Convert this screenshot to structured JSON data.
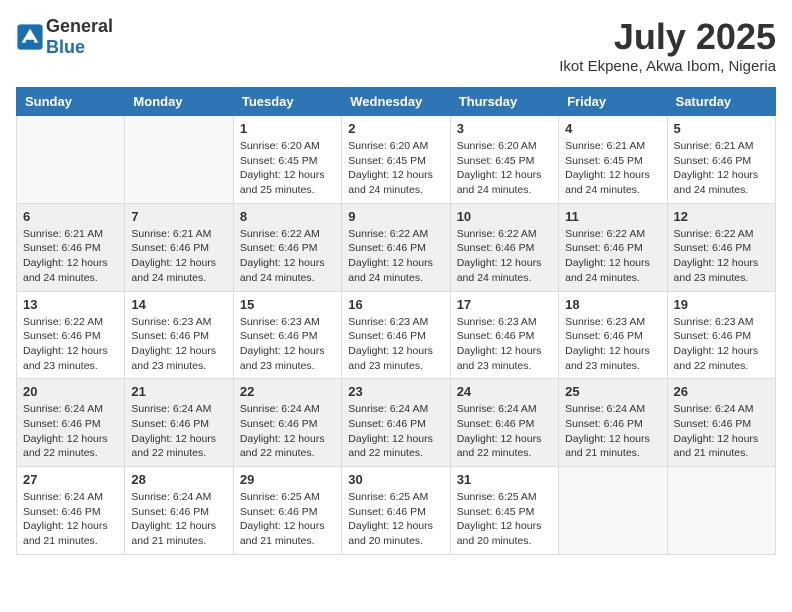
{
  "logo": {
    "general": "General",
    "blue": "Blue"
  },
  "header": {
    "month": "July 2025",
    "location": "Ikot Ekpene, Akwa Ibom, Nigeria"
  },
  "weekdays": [
    "Sunday",
    "Monday",
    "Tuesday",
    "Wednesday",
    "Thursday",
    "Friday",
    "Saturday"
  ],
  "weeks": [
    [
      {
        "day": "",
        "sunrise": "",
        "sunset": "",
        "daylight": "",
        "empty": true
      },
      {
        "day": "",
        "sunrise": "",
        "sunset": "",
        "daylight": "",
        "empty": true
      },
      {
        "day": "1",
        "sunrise": "Sunrise: 6:20 AM",
        "sunset": "Sunset: 6:45 PM",
        "daylight": "Daylight: 12 hours and 25 minutes."
      },
      {
        "day": "2",
        "sunrise": "Sunrise: 6:20 AM",
        "sunset": "Sunset: 6:45 PM",
        "daylight": "Daylight: 12 hours and 24 minutes."
      },
      {
        "day": "3",
        "sunrise": "Sunrise: 6:20 AM",
        "sunset": "Sunset: 6:45 PM",
        "daylight": "Daylight: 12 hours and 24 minutes."
      },
      {
        "day": "4",
        "sunrise": "Sunrise: 6:21 AM",
        "sunset": "Sunset: 6:45 PM",
        "daylight": "Daylight: 12 hours and 24 minutes."
      },
      {
        "day": "5",
        "sunrise": "Sunrise: 6:21 AM",
        "sunset": "Sunset: 6:46 PM",
        "daylight": "Daylight: 12 hours and 24 minutes."
      }
    ],
    [
      {
        "day": "6",
        "sunrise": "Sunrise: 6:21 AM",
        "sunset": "Sunset: 6:46 PM",
        "daylight": "Daylight: 12 hours and 24 minutes."
      },
      {
        "day": "7",
        "sunrise": "Sunrise: 6:21 AM",
        "sunset": "Sunset: 6:46 PM",
        "daylight": "Daylight: 12 hours and 24 minutes."
      },
      {
        "day": "8",
        "sunrise": "Sunrise: 6:22 AM",
        "sunset": "Sunset: 6:46 PM",
        "daylight": "Daylight: 12 hours and 24 minutes."
      },
      {
        "day": "9",
        "sunrise": "Sunrise: 6:22 AM",
        "sunset": "Sunset: 6:46 PM",
        "daylight": "Daylight: 12 hours and 24 minutes."
      },
      {
        "day": "10",
        "sunrise": "Sunrise: 6:22 AM",
        "sunset": "Sunset: 6:46 PM",
        "daylight": "Daylight: 12 hours and 24 minutes."
      },
      {
        "day": "11",
        "sunrise": "Sunrise: 6:22 AM",
        "sunset": "Sunset: 6:46 PM",
        "daylight": "Daylight: 12 hours and 24 minutes."
      },
      {
        "day": "12",
        "sunrise": "Sunrise: 6:22 AM",
        "sunset": "Sunset: 6:46 PM",
        "daylight": "Daylight: 12 hours and 23 minutes."
      }
    ],
    [
      {
        "day": "13",
        "sunrise": "Sunrise: 6:22 AM",
        "sunset": "Sunset: 6:46 PM",
        "daylight": "Daylight: 12 hours and 23 minutes."
      },
      {
        "day": "14",
        "sunrise": "Sunrise: 6:23 AM",
        "sunset": "Sunset: 6:46 PM",
        "daylight": "Daylight: 12 hours and 23 minutes."
      },
      {
        "day": "15",
        "sunrise": "Sunrise: 6:23 AM",
        "sunset": "Sunset: 6:46 PM",
        "daylight": "Daylight: 12 hours and 23 minutes."
      },
      {
        "day": "16",
        "sunrise": "Sunrise: 6:23 AM",
        "sunset": "Sunset: 6:46 PM",
        "daylight": "Daylight: 12 hours and 23 minutes."
      },
      {
        "day": "17",
        "sunrise": "Sunrise: 6:23 AM",
        "sunset": "Sunset: 6:46 PM",
        "daylight": "Daylight: 12 hours and 23 minutes."
      },
      {
        "day": "18",
        "sunrise": "Sunrise: 6:23 AM",
        "sunset": "Sunset: 6:46 PM",
        "daylight": "Daylight: 12 hours and 23 minutes."
      },
      {
        "day": "19",
        "sunrise": "Sunrise: 6:23 AM",
        "sunset": "Sunset: 6:46 PM",
        "daylight": "Daylight: 12 hours and 22 minutes."
      }
    ],
    [
      {
        "day": "20",
        "sunrise": "Sunrise: 6:24 AM",
        "sunset": "Sunset: 6:46 PM",
        "daylight": "Daylight: 12 hours and 22 minutes."
      },
      {
        "day": "21",
        "sunrise": "Sunrise: 6:24 AM",
        "sunset": "Sunset: 6:46 PM",
        "daylight": "Daylight: 12 hours and 22 minutes."
      },
      {
        "day": "22",
        "sunrise": "Sunrise: 6:24 AM",
        "sunset": "Sunset: 6:46 PM",
        "daylight": "Daylight: 12 hours and 22 minutes."
      },
      {
        "day": "23",
        "sunrise": "Sunrise: 6:24 AM",
        "sunset": "Sunset: 6:46 PM",
        "daylight": "Daylight: 12 hours and 22 minutes."
      },
      {
        "day": "24",
        "sunrise": "Sunrise: 6:24 AM",
        "sunset": "Sunset: 6:46 PM",
        "daylight": "Daylight: 12 hours and 22 minutes."
      },
      {
        "day": "25",
        "sunrise": "Sunrise: 6:24 AM",
        "sunset": "Sunset: 6:46 PM",
        "daylight": "Daylight: 12 hours and 21 minutes."
      },
      {
        "day": "26",
        "sunrise": "Sunrise: 6:24 AM",
        "sunset": "Sunset: 6:46 PM",
        "daylight": "Daylight: 12 hours and 21 minutes."
      }
    ],
    [
      {
        "day": "27",
        "sunrise": "Sunrise: 6:24 AM",
        "sunset": "Sunset: 6:46 PM",
        "daylight": "Daylight: 12 hours and 21 minutes."
      },
      {
        "day": "28",
        "sunrise": "Sunrise: 6:24 AM",
        "sunset": "Sunset: 6:46 PM",
        "daylight": "Daylight: 12 hours and 21 minutes."
      },
      {
        "day": "29",
        "sunrise": "Sunrise: 6:25 AM",
        "sunset": "Sunset: 6:46 PM",
        "daylight": "Daylight: 12 hours and 21 minutes."
      },
      {
        "day": "30",
        "sunrise": "Sunrise: 6:25 AM",
        "sunset": "Sunset: 6:46 PM",
        "daylight": "Daylight: 12 hours and 20 minutes."
      },
      {
        "day": "31",
        "sunrise": "Sunrise: 6:25 AM",
        "sunset": "Sunset: 6:45 PM",
        "daylight": "Daylight: 12 hours and 20 minutes."
      },
      {
        "day": "",
        "sunrise": "",
        "sunset": "",
        "daylight": "",
        "empty": true
      },
      {
        "day": "",
        "sunrise": "",
        "sunset": "",
        "daylight": "",
        "empty": true
      }
    ]
  ]
}
